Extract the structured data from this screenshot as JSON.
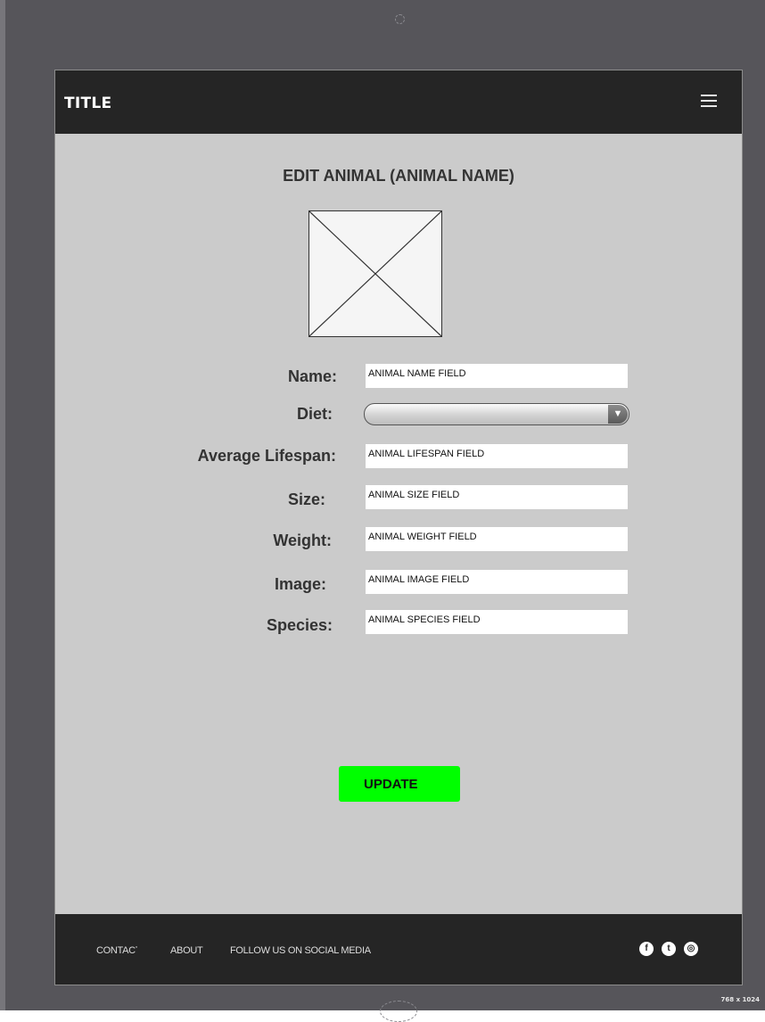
{
  "header": {
    "title": "TITLE",
    "menu_icon": "hamburger-menu-icon"
  },
  "page": {
    "heading": "EDIT ANIMAL (ANIMAL NAME)",
    "image_icon": "image-placeholder-icon"
  },
  "form": {
    "name": {
      "label": "Name:",
      "value": "ANIMAL NAME FIELD"
    },
    "diet": {
      "label": "Diet:",
      "value": "",
      "arrow": "▼"
    },
    "lifespan": {
      "label": "Average Lifespan:",
      "value": "ANIMAL LIFESPAN FIELD"
    },
    "size": {
      "label": "Size:",
      "value": "ANIMAL SIZE FIELD"
    },
    "weight": {
      "label": "Weight:",
      "value": "ANIMAL WEIGHT FIELD"
    },
    "image": {
      "label": "Image:",
      "value": "ANIMAL IMAGE FIELD"
    },
    "species": {
      "label": "Species:",
      "value": "ANIMAL SPECIES FIELD"
    }
  },
  "actions": {
    "update_label": "UPDATE"
  },
  "footer": {
    "links": [
      "CONTACT",
      "ABOUT",
      "FOLLOW US ON SOCIAL MEDIA"
    ],
    "social_icons": [
      "facebook-icon",
      "twitter-icon",
      "instagram-icon"
    ]
  },
  "device": {
    "size_label": "768 x 1024"
  },
  "colors": {
    "bar_background": "#252525",
    "screen_background": "#cbcbcb",
    "update_button": "#00ff00",
    "device_frame": "#56555a"
  }
}
